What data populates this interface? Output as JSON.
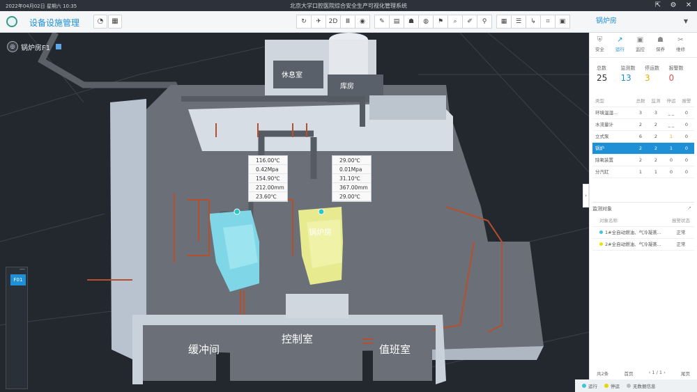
{
  "titlebar": {
    "datetime": "2022年04月02日 星期六 10:35",
    "title": "北京大学口腔医院综合安全生产可视化管理系统"
  },
  "toolbar": {
    "app_title": "设备设施管理",
    "room_select": "锅炉房",
    "view_2d": "2D"
  },
  "viewport": {
    "floor_label": "锅炉房F1",
    "floor_button": "F01",
    "rooms": {
      "rest": "休息室",
      "storage": "库房",
      "boiler": "锅炉房",
      "buffer": "缓冲间",
      "control": "控制室",
      "duty": "值班室"
    },
    "tag_left": [
      "116.00℃",
      "0.42Mpa",
      "154.90℃",
      "212.00mm",
      "23.60℃"
    ],
    "tag_right": [
      "29.00℃",
      "0.01Mpa",
      "31.10℃",
      "367.00mm",
      "29.00℃"
    ]
  },
  "side": {
    "tabs": [
      "安全",
      "运行",
      "监控",
      "保养",
      "维修"
    ],
    "run_badge": "25",
    "stats": [
      {
        "label": "总数",
        "value": "25",
        "color": "#333333"
      },
      {
        "label": "监测数",
        "value": "13",
        "color": "#1f8fd6"
      },
      {
        "label": "停运数",
        "value": "3",
        "color": "#e0b000"
      },
      {
        "label": "报警数",
        "value": "0",
        "color": "#e05050"
      }
    ],
    "table_header": [
      "类型",
      "总数",
      "监测",
      "停运",
      "报警"
    ],
    "table_rows": [
      [
        "环境温湿...",
        "3",
        "3",
        "_ _",
        "0"
      ],
      [
        "水流量计",
        "2",
        "2",
        "_ _",
        "0"
      ],
      [
        "立式泵",
        "6",
        "2",
        "1",
        "0"
      ],
      [
        "锅炉",
        "2",
        "2",
        "1",
        "0"
      ],
      [
        "除氧装置",
        "2",
        "2",
        "0",
        "0"
      ],
      [
        "分汽缸",
        "1",
        "1",
        "0",
        "0"
      ]
    ],
    "monitor_title": "监测对象",
    "obj_header": [
      "对象名称",
      "报警状态"
    ],
    "obj_rows": [
      {
        "name": "1#全自动燃油、气冷凝蒸...",
        "status": "正常",
        "color": "#3cc6d9"
      },
      {
        "name": "2#全自动燃油、气冷凝蒸...",
        "status": "正常",
        "color": "#e6e600"
      }
    ],
    "pager": {
      "total": "共2条",
      "first": "首页",
      "page": "1",
      "pages": "/ 1",
      "last": "尾页"
    }
  },
  "legend": [
    {
      "label": "运行",
      "color": "#3cc6d9"
    },
    {
      "label": "停运",
      "color": "#e6d600"
    },
    {
      "label": "无数据信息",
      "color": "#bbbbbb"
    }
  ]
}
